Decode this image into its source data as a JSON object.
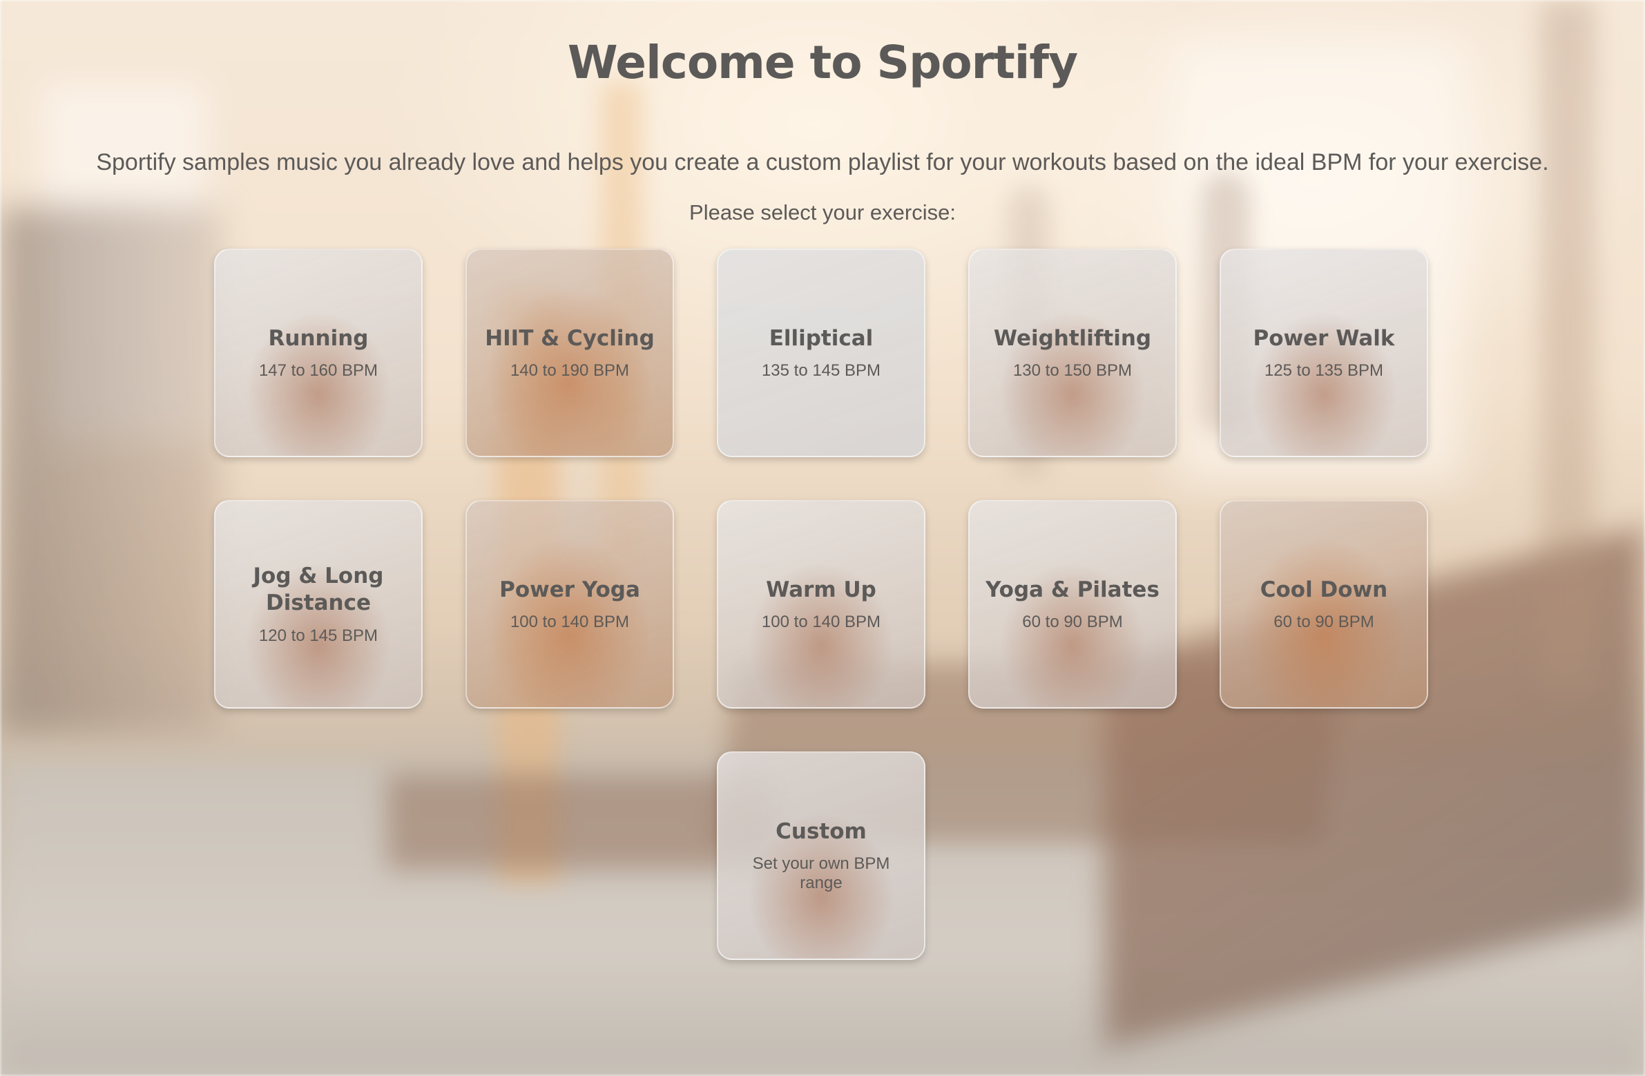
{
  "header": {
    "title": "Welcome to Sportify",
    "subtitle": "Sportify samples music you already love and helps you create a custom playlist for your workouts based on the ideal BPM for your exercise.",
    "prompt": "Please select your exercise:"
  },
  "exercises": [
    {
      "name": "Running",
      "bpm": "147 to 160 BPM"
    },
    {
      "name": "HIIT & Cycling",
      "bpm": "140 to 190 BPM"
    },
    {
      "name": "Elliptical",
      "bpm": "135 to 145 BPM"
    },
    {
      "name": "Weightlifting",
      "bpm": "130 to 150 BPM"
    },
    {
      "name": "Power Walk",
      "bpm": "125 to 135 BPM"
    },
    {
      "name": "Jog & Long Distance",
      "bpm": "120 to 145 BPM"
    },
    {
      "name": "Power Yoga",
      "bpm": "100 to 140 BPM"
    },
    {
      "name": "Warm Up",
      "bpm": "100 to 140 BPM"
    },
    {
      "name": "Yoga & Pilates",
      "bpm": "60 to 90 BPM"
    },
    {
      "name": "Cool Down",
      "bpm": "60 to 90 BPM"
    },
    {
      "name": "Custom",
      "bpm": "Set your own BPM range"
    }
  ],
  "colors": {
    "text": "#5c5a58",
    "card_border": "#ffffff"
  }
}
